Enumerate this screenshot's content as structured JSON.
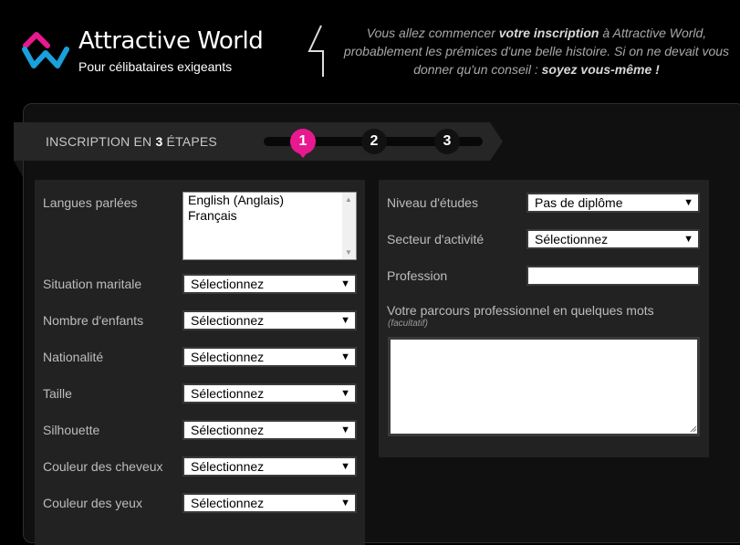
{
  "brand": {
    "name": "Attractive World",
    "tagline": "Pour célibataires exigeants"
  },
  "intro": {
    "p1": "Vous allez commencer ",
    "b1": "votre inscription",
    "p2": " à Attractive World, probablement les prémices d'une belle histoire. Si on ne devait vous donner qu'un conseil : ",
    "b2": "soyez vous-même !"
  },
  "steps": {
    "title_pre": "INSCRIPTION EN ",
    "title_num": "3",
    "title_post": " ÉTAPES",
    "items": [
      "1",
      "2",
      "3"
    ],
    "active_color": "#e8198f"
  },
  "left": {
    "languages_label": "Langues parlées",
    "languages_options": [
      "English (Anglais)",
      "Français"
    ],
    "fields": [
      {
        "label": "Situation maritale",
        "value": "Sélectionnez"
      },
      {
        "label": "Nombre d'enfants",
        "value": "Sélectionnez"
      },
      {
        "label": "Nationalité",
        "value": "Sélectionnez"
      },
      {
        "label": "Taille",
        "value": "Sélectionnez"
      },
      {
        "label": "Silhouette",
        "value": "Sélectionnez"
      },
      {
        "label": "Couleur des cheveux",
        "value": "Sélectionnez"
      },
      {
        "label": "Couleur des yeux",
        "value": "Sélectionnez"
      }
    ]
  },
  "right": {
    "education_label": "Niveau d'études",
    "education_value": "Pas de diplôme",
    "sector_label": "Secteur d'activité",
    "sector_value": "Sélectionnez",
    "profession_label": "Profession",
    "profession_value": "",
    "career_label": "Votre parcours professionnel en quelques mots",
    "career_hint": "(facultatif)",
    "career_value": ""
  },
  "icons": {
    "dropdown": "▼",
    "scroll_up": "▲",
    "scroll_down": "▼"
  }
}
